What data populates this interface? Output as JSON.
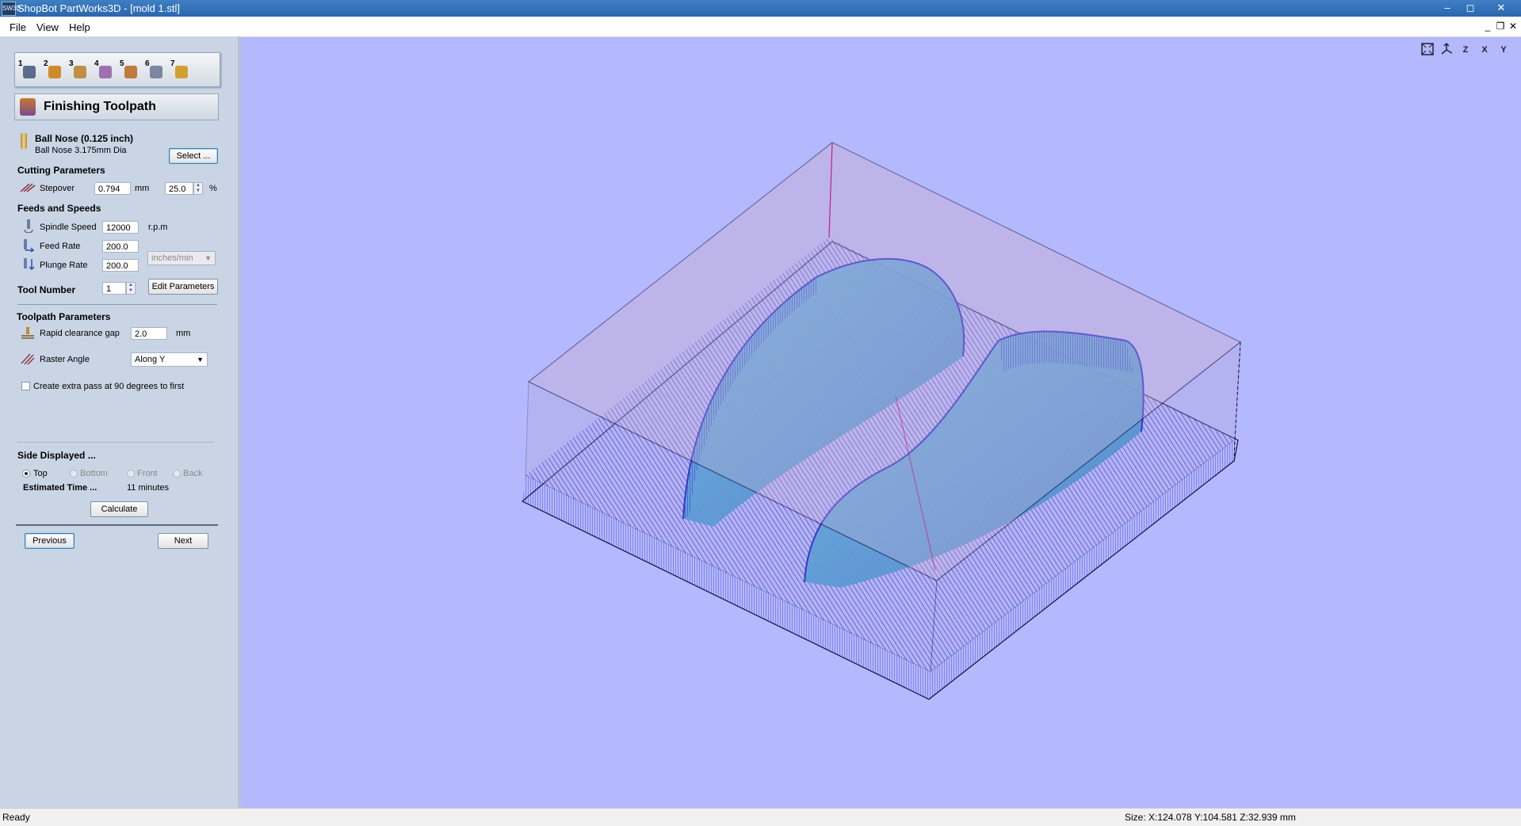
{
  "window": {
    "app_icon_label": "SW3D",
    "title": "ShopBot PartWorks3D - [mold 1.stl]",
    "minimize": "–",
    "maximize": "◻",
    "close": "✕"
  },
  "menu": {
    "items": [
      "File",
      "View",
      "Help"
    ],
    "mdi_minimize": "_",
    "mdi_restore": "❐",
    "mdi_close": "✕"
  },
  "steps": {
    "numbers": [
      "1",
      "2",
      "3",
      "4",
      "5",
      "6",
      "7"
    ],
    "colors": [
      "#5a6b8c",
      "#d08a2c",
      "#c09040",
      "#a070b0",
      "#c07a3a",
      "#7a88a0",
      "#d0a030"
    ]
  },
  "panel": {
    "heading": "Finishing Toolpath",
    "tool": {
      "name": "Ball Nose (0.125 inch)",
      "description": "Ball Nose 3.175mm Dia",
      "select_label": "Select ..."
    },
    "cutting": {
      "title": "Cutting Parameters",
      "stepover_label": "Stepover",
      "stepover_value": "0.794",
      "stepover_unit": "mm",
      "stepover_percent": "25.0",
      "percent_symbol": "%"
    },
    "feeds": {
      "title": "Feeds and Speeds",
      "spindle_label": "Spindle Speed",
      "spindle_value": "12000",
      "spindle_unit": "r.p.m",
      "feed_label": "Feed Rate",
      "feed_value": "200.0",
      "plunge_label": "Plunge Rate",
      "plunge_value": "200.0",
      "rate_unit": "inches/min"
    },
    "tool_number": {
      "label": "Tool Number",
      "value": "1",
      "edit_label": "Edit Parameters"
    },
    "toolpath": {
      "title": "Toolpath Parameters",
      "clearance_label": "Rapid clearance gap",
      "clearance_value": "2.0",
      "clearance_unit": "mm",
      "raster_label": "Raster Angle",
      "raster_value": "Along Y",
      "extra_pass_label": "Create extra pass at 90 degrees to first"
    },
    "side": {
      "title": "Side Displayed ...",
      "options": [
        "Top",
        "Bottom",
        "Front",
        "Back"
      ],
      "selected": "Top"
    },
    "time": {
      "label": "Estimated Time ...",
      "value": "11 minutes",
      "calculate_label": "Calculate"
    },
    "nav": {
      "previous_label": "Previous",
      "next_label": "Next"
    }
  },
  "view_toolbar": [
    "Z",
    "X",
    "Y"
  ],
  "status": {
    "left": "Ready",
    "size": "Size: X:124.078 Y:104.581 Z:32.939 mm"
  },
  "colors": {
    "viewport_bg": "#b4b8fc",
    "toolpath": "#0a10c8",
    "model": "#3aa0d8"
  }
}
